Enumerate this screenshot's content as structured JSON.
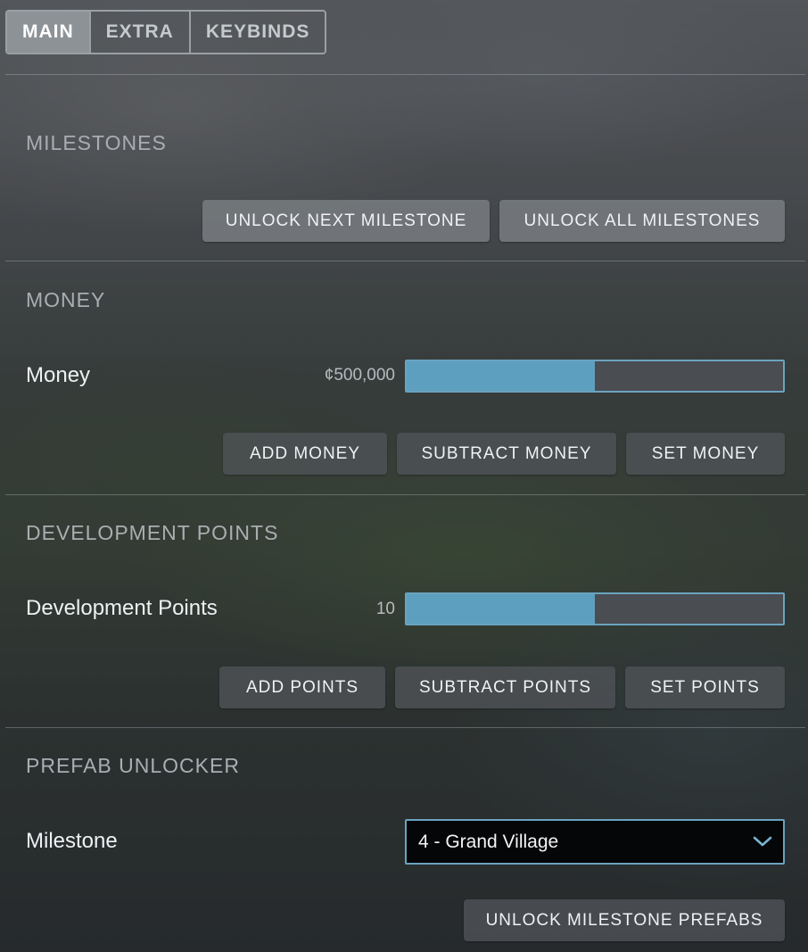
{
  "tabs": [
    {
      "label": "MAIN",
      "active": true
    },
    {
      "label": "EXTRA",
      "active": false
    },
    {
      "label": "KEYBINDS",
      "active": false
    }
  ],
  "milestones": {
    "title": "MILESTONES",
    "unlock_next_label": "UNLOCK NEXT MILESTONE",
    "unlock_all_label": "UNLOCK ALL MILESTONES"
  },
  "money": {
    "title": "MONEY",
    "label": "Money",
    "value": "¢500,000",
    "slider_fraction": 0.5,
    "add_label": "ADD MONEY",
    "subtract_label": "SUBTRACT MONEY",
    "set_label": "SET MONEY"
  },
  "development_points": {
    "title": "DEVELOPMENT POINTS",
    "label": "Development Points",
    "value": "10",
    "slider_fraction": 0.5,
    "add_label": "ADD POINTS",
    "subtract_label": "SUBTRACT POINTS",
    "set_label": "SET POINTS"
  },
  "prefab_unlocker": {
    "title": "PREFAB UNLOCKER",
    "label": "Milestone",
    "selected": "4 - Grand Village",
    "unlock_label": "UNLOCK MILESTONE PREFABS"
  },
  "colors": {
    "accent": "#5d9fbe",
    "accent_border": "#6aa3c0"
  },
  "icons": {
    "dropdown": "chevron-down-icon"
  }
}
